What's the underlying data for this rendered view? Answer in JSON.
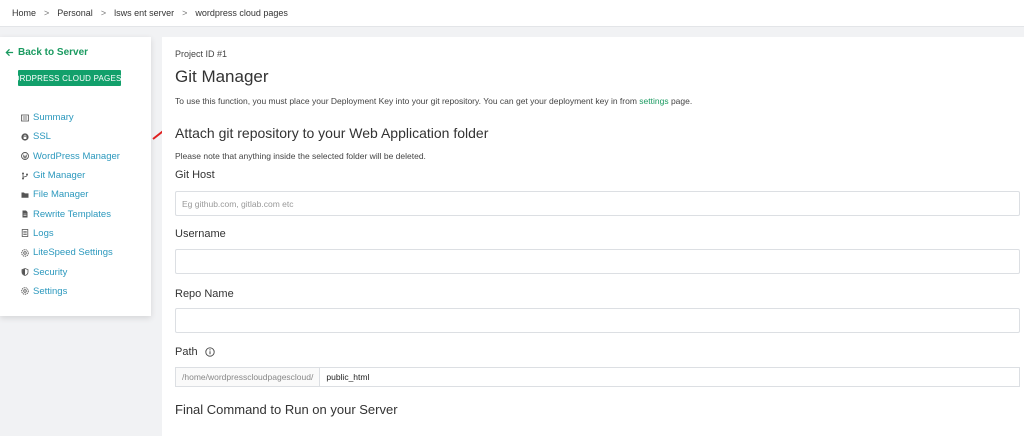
{
  "breadcrumb": {
    "items": [
      "Home",
      "Personal",
      "lsws ent server",
      "wordpress cloud pages"
    ],
    "separator": ">"
  },
  "sidebar": {
    "back_label": "Back to Server",
    "project_badge": "WORDPRESS CLOUD PAGES",
    "items": [
      {
        "label": "Summary",
        "icon": "list-icon"
      },
      {
        "label": "SSL",
        "icon": "lock-icon"
      },
      {
        "label": "WordPress Manager",
        "icon": "wordpress-icon"
      },
      {
        "label": "Git Manager",
        "icon": "git-branch-icon"
      },
      {
        "label": "File Manager",
        "icon": "folder-icon"
      },
      {
        "label": "Rewrite Templates",
        "icon": "file-icon"
      },
      {
        "label": "Logs",
        "icon": "document-icon"
      },
      {
        "label": "LiteSpeed Settings",
        "icon": "gear-icon"
      },
      {
        "label": "Security",
        "icon": "shield-icon"
      },
      {
        "label": "Settings",
        "icon": "gear-icon"
      }
    ]
  },
  "main": {
    "project_id": "Project ID #1",
    "title": "Git Manager",
    "desc_before": "To use this function, you must place your Deployment Key into your git repository. You can get your deployment key in from ",
    "desc_link": "settings",
    "desc_after": " page.",
    "section_title": "Attach git repository to your Web Application folder",
    "note": "Please note that anything inside the selected folder will be deleted.",
    "git_host_label": "Git Host",
    "git_host_placeholder": "Eg github.com, gitlab.com etc",
    "username_label": "Username",
    "repo_label": "Repo Name",
    "path_label": "Path",
    "path_prefix": "/home/wordpresscloudpagescloud/",
    "path_value": "public_html",
    "final_title": "Final Command to Run on your Server"
  },
  "colors": {
    "accent_green": "#12a06b",
    "link_blue": "#2b98bd",
    "annotation_red": "#e02020"
  }
}
